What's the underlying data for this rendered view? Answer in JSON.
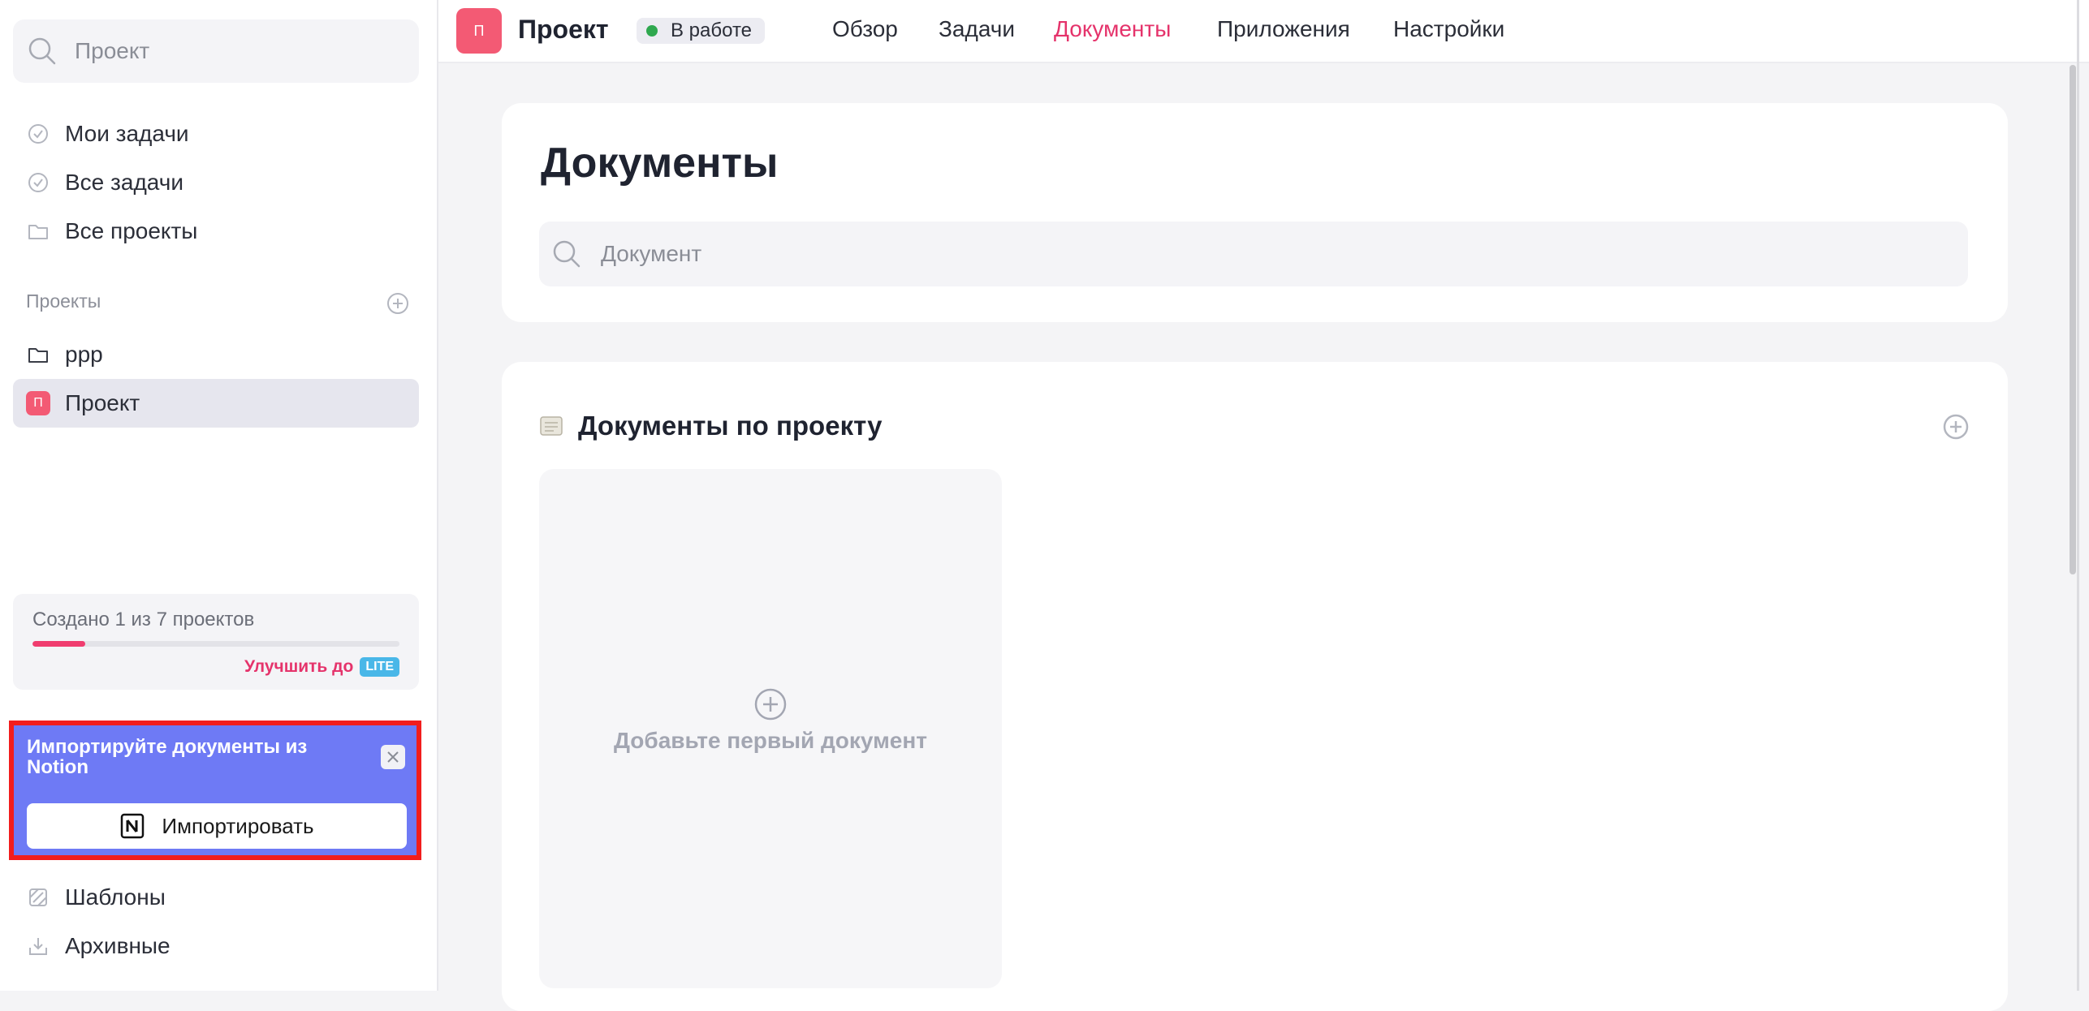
{
  "sidebar": {
    "search_placeholder": "Проект",
    "nav": [
      {
        "label": "Мои задачи",
        "icon": "check-circle-icon"
      },
      {
        "label": "Все задачи",
        "icon": "check-circle-icon"
      },
      {
        "label": "Все проекты",
        "icon": "folder-icon"
      }
    ],
    "projects_section": "Проекты",
    "projects": [
      {
        "label": "ppp",
        "icon": "folder-icon"
      },
      {
        "label": "Проект",
        "avatar": "П",
        "active": true
      }
    ],
    "limit": {
      "text": "Создано 1 из 7 проектов",
      "progress": 0.143,
      "upgrade_label": "Улучшить до",
      "plan_badge": "LITE"
    },
    "notion_promo": {
      "title": "Импортируйте документы из Notion",
      "button_label": "Импортировать"
    },
    "bottom": [
      {
        "label": "Шаблоны",
        "icon": "templates-icon"
      },
      {
        "label": "Архивные",
        "icon": "archive-icon"
      }
    ]
  },
  "header": {
    "avatar": "П",
    "title": "Проект",
    "status": "В работе",
    "status_color": "#2fa84f",
    "tabs": [
      {
        "label": "Обзор"
      },
      {
        "label": "Задачи"
      },
      {
        "label": "Документы",
        "active": true
      },
      {
        "label": "Приложения"
      },
      {
        "label": "Настройки"
      }
    ]
  },
  "main": {
    "page_title": "Документы",
    "search_placeholder": "Документ",
    "section_title": "Документы по проекту",
    "add_doc_text": "Добавьте первый документ"
  },
  "colors": {
    "accent": "#e5336b",
    "project": "#f35a74",
    "promo": "#6e7af5",
    "highlight": "#f21d1d"
  }
}
